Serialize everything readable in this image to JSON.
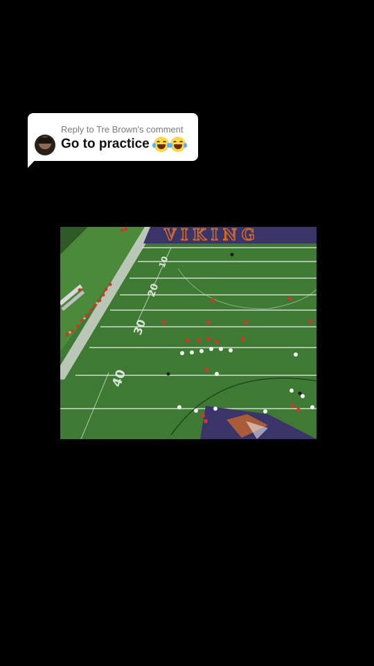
{
  "reply": {
    "meta": "Reply to Tre Brown's comment",
    "text": "Go to practice",
    "emojis": [
      "face-with-tears-of-joy",
      "face-with-tears-of-joy"
    ]
  },
  "video": {
    "end_zone_text": "VIKING",
    "yard_numbers": [
      "10",
      "20",
      "30",
      "40"
    ],
    "colors": {
      "turf": "#3f7a35",
      "end_zone": "#3a3468",
      "end_zone_letters": "#d06a2a"
    }
  }
}
